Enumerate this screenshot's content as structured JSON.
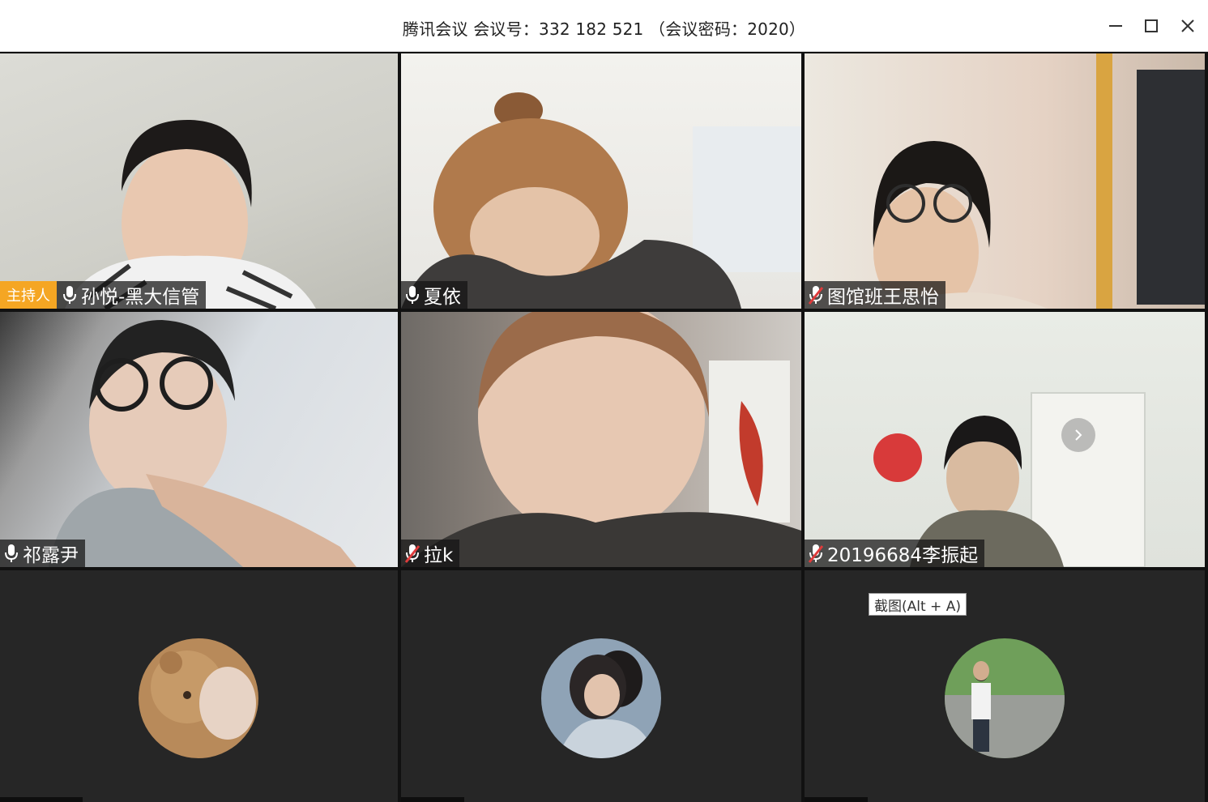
{
  "window": {
    "title": "腾讯会议 会议号：332 182 521 （会议密码：2020）",
    "controls": [
      "minimize-icon",
      "maximize-icon",
      "close-icon"
    ]
  },
  "host_badge": "主持人",
  "participants": [
    {
      "name": "孙悦-黑大信管",
      "mic": "on",
      "host": true,
      "video": true
    },
    {
      "name": "夏依",
      "mic": "on",
      "host": false,
      "video": true
    },
    {
      "name": "图馆班王思怡",
      "mic": "muted",
      "host": false,
      "video": true
    },
    {
      "name": "祁露尹",
      "mic": "on",
      "host": false,
      "video": true
    },
    {
      "name": "拉k",
      "mic": "muted",
      "host": false,
      "video": true
    },
    {
      "name": "20196684李振起",
      "mic": "muted",
      "host": false,
      "video": true
    },
    {
      "name": "",
      "video": false,
      "avatar": "teddy-bear-photo"
    },
    {
      "name": "",
      "video": false,
      "avatar": "couple-photo"
    },
    {
      "name": "",
      "video": false,
      "avatar": "man-outdoors-photo"
    }
  ],
  "tooltip": "截图(Alt + A)",
  "colors": {
    "host_badge": "#f5a623",
    "tile_bg": "#262626",
    "muted_red": "#e03b3b"
  }
}
